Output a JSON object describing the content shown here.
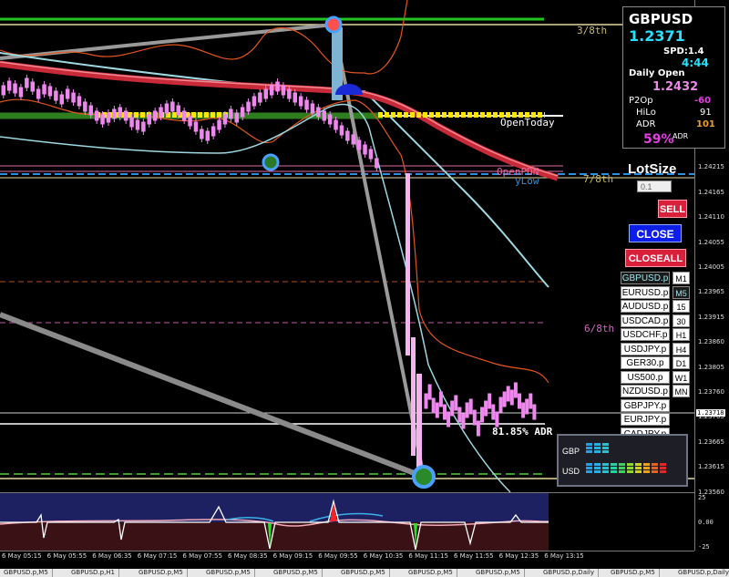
{
  "chart": {
    "price_ticks": [
      "1.24515",
      "1.24460",
      "1.24405",
      "1.24350",
      "1.24310",
      "1.24255",
      "1.24215",
      "1.24165",
      "1.24110",
      "1.24055",
      "1.24005",
      "1.23965",
      "1.23915",
      "1.23860",
      "1.23805",
      "1.23760",
      "1.23705",
      "1.23665",
      "1.23615",
      "1.23560"
    ],
    "current_price_tag": "1.23718",
    "time_ticks": [
      "6 May 05:15",
      "6 May 05:55",
      "6 May 06:35",
      "6 May 07:15",
      "6 May 07:55",
      "6 May 08:35",
      "6 May 09:15",
      "6 May 09:55",
      "6 May 10:35",
      "6 May 11:15",
      "6 May 11:55",
      "6 May 12:35",
      "6 May 13:15"
    ],
    "levels": {
      "eighth_3": "3/8th",
      "eighth_7": "7/8th",
      "eighth_6": "6/8th",
      "open_today": "OpenToday",
      "open_pdn": "OpenPDN",
      "y_low": "yLow",
      "adr_pct": "81.85% ADR"
    },
    "colors": {
      "bg": "#000000",
      "green_line": "#22c322",
      "yellow_dots": "#ffe600",
      "red_ma": "#d22a3c",
      "candle": "#ee88ee",
      "blue_level": "#2b8fe0",
      "orange_band": "#e3541e"
    }
  },
  "info_panel": {
    "symbol": "GBPUSD",
    "price": "1.2371",
    "spread": "SPD:1.4",
    "timer": "4:44",
    "daily_open_label": "Daily Open",
    "daily_open_value": "1.2432",
    "p2o_label": "P2Op",
    "p2o_value": "-60",
    "hilo_label": "HiLo",
    "hilo_value": "91",
    "adr_label": "ADR",
    "adr_value": "101",
    "adr_pct": "59%",
    "adr_suffix": "ADR"
  },
  "trade_panel": {
    "lotsize_label": "LotSize",
    "lotsize_value": "0.1",
    "sell": "SELL",
    "close": "CLOSE",
    "closeall": "CLOSEALL"
  },
  "symbols": [
    "GBPUSD.p",
    "EURUSD.p",
    "AUDUSD.p",
    "USDCAD.p",
    "USDCHF.p",
    "USDJPY.p",
    "GER30.p",
    "US500.p",
    "NZDUSD.p",
    "GBPJPY.p",
    "EURJPY.p",
    "CADJPY.p"
  ],
  "timeframes": [
    "M1",
    "M5",
    "15",
    "30",
    "H1",
    "H4",
    "D1",
    "W1",
    "MN"
  ],
  "strength": {
    "gbp_label": "GBP",
    "usd_label": "USD",
    "gbp_level": 0.3,
    "usd_level": 1.0
  },
  "sub_indicator": {
    "ticks": [
      "25",
      "0.00",
      "-25"
    ]
  },
  "tabs": [
    "GBPUSD.p,M5",
    "GBPUSD.p,H1",
    "GBPUSD.p,M5",
    "GBPUSD.p,M5",
    "GBPUSD.p,M5",
    "GBPUSD.p,M5",
    "GBPUSD.p,M5",
    "GBPUSD.p,M5",
    "GBPUSD.p,Daily",
    "GBPUSD.p,M5",
    "GBPUSD.p,Daily"
  ]
}
